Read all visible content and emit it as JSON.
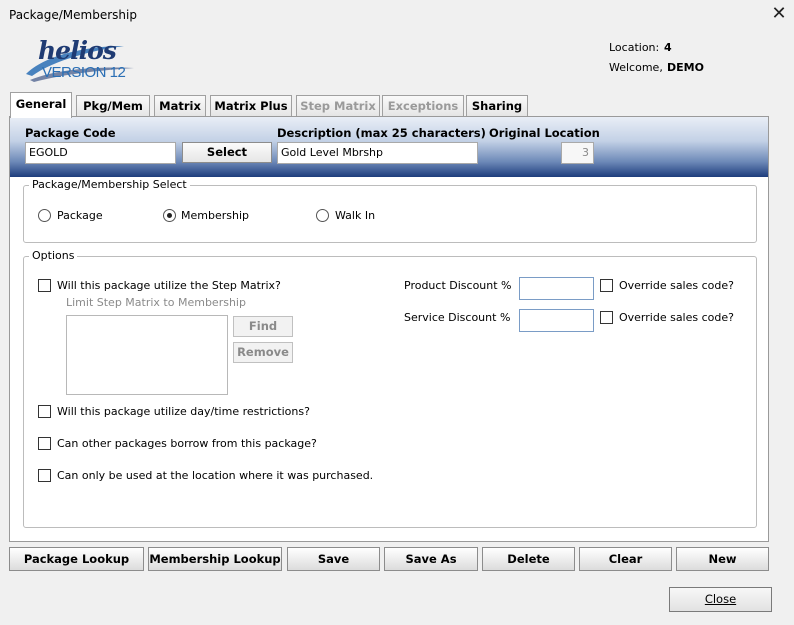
{
  "window": {
    "title": "Package/Membership",
    "close_glyph": "✕"
  },
  "logo": {
    "brand": "helios",
    "version": "VERSION 12"
  },
  "header_info": {
    "location_label": "Location:",
    "location_value": "4",
    "welcome_label": "Welcome,",
    "welcome_value": "DEMO"
  },
  "tabs": [
    {
      "label": "General",
      "state": "active"
    },
    {
      "label": "Pkg/Mem",
      "state": "enabled"
    },
    {
      "label": "Matrix",
      "state": "enabled"
    },
    {
      "label": "Matrix Plus",
      "state": "enabled"
    },
    {
      "label": "Step Matrix",
      "state": "disabled"
    },
    {
      "label": "Exceptions",
      "state": "disabled"
    },
    {
      "label": "Sharing",
      "state": "enabled"
    }
  ],
  "header_fields": {
    "package_code_label": "Package Code",
    "package_code_value": "EGOLD",
    "select_button": "Select",
    "description_label": "Description (max 25 characters)",
    "description_value": "Gold Level Mbrshp",
    "original_location_label": "Original Location",
    "original_location_value": "3"
  },
  "select_group": {
    "title": "Package/Membership Select",
    "options": [
      {
        "label": "Package",
        "selected": false
      },
      {
        "label": "Membership",
        "selected": true
      },
      {
        "label": "Walk In",
        "selected": false
      }
    ]
  },
  "options_group": {
    "title": "Options",
    "step_matrix_label": "Will this package utilize the Step Matrix?",
    "limit_label": "Limit Step Matrix to Membership",
    "find_button": "Find",
    "remove_button": "Remove",
    "day_time_label": "Will this package utilize day/time restrictions?",
    "borrow_label": "Can other packages borrow from this package?",
    "location_only_label": "Can only be used at the location where it was purchased.",
    "product_discount_label": "Product Discount %",
    "product_discount_value": "",
    "service_discount_label": "Service Discount %",
    "service_discount_value": "",
    "override_label_1": "Override sales code?",
    "override_label_2": "Override sales code?"
  },
  "bottom_buttons": {
    "package_lookup": "Package Lookup",
    "membership_lookup": "Membership Lookup",
    "save": "Save",
    "save_as": "Save As",
    "delete": "Delete",
    "clear": "Clear",
    "new": "New"
  },
  "close_button": {
    "label": "Close"
  },
  "colors": {
    "header_gradient_top": "#e9eef6",
    "header_gradient_bottom": "#1d3d7c",
    "logo_dark": "#1f3b73",
    "logo_light": "#2a6fb5",
    "disabled_text": "#9a9a9a"
  }
}
